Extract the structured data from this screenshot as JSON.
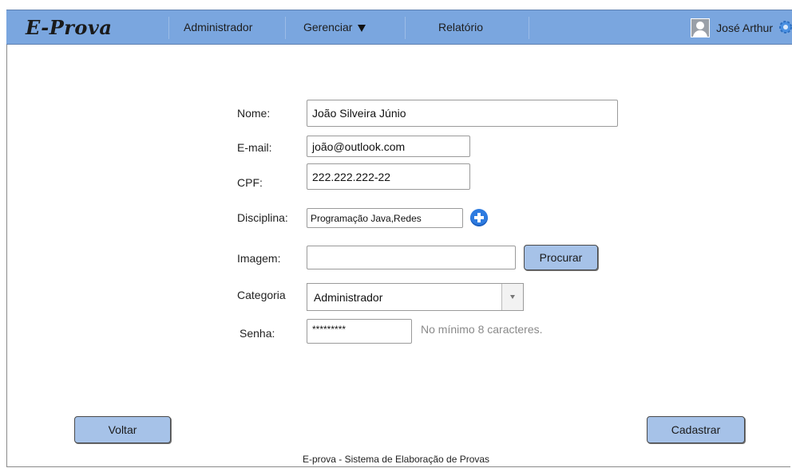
{
  "header": {
    "logo": "E-Prova",
    "nav": {
      "admin": "Administrador",
      "manage": "Gerenciar",
      "report": "Relatório"
    },
    "user": "José Arthur",
    "accent_color": "#7aa6df"
  },
  "form": {
    "nome": {
      "label": "Nome:",
      "value": "João Silveira Júnio"
    },
    "email": {
      "label": "E-mail:",
      "value": "joão@outlook.com"
    },
    "cpf": {
      "label": "CPF:",
      "value": "222.222.222-22"
    },
    "disciplina": {
      "label": "Disciplina:",
      "value": "Programação Java,Redes",
      "add_icon": "plus-circle-icon"
    },
    "imagem": {
      "label": "Imagem:",
      "value": "",
      "browse_button": "Procurar"
    },
    "categoria": {
      "label": "Categoria",
      "selected": "Administrador"
    },
    "senha": {
      "label": "Senha:",
      "value": "*********",
      "hint": "No mínimo 8 caracteres."
    }
  },
  "actions": {
    "back": "Voltar",
    "submit": "Cadastrar"
  },
  "footer": {
    "text": "E-prova - Sistema de Elaboração de Provas"
  }
}
